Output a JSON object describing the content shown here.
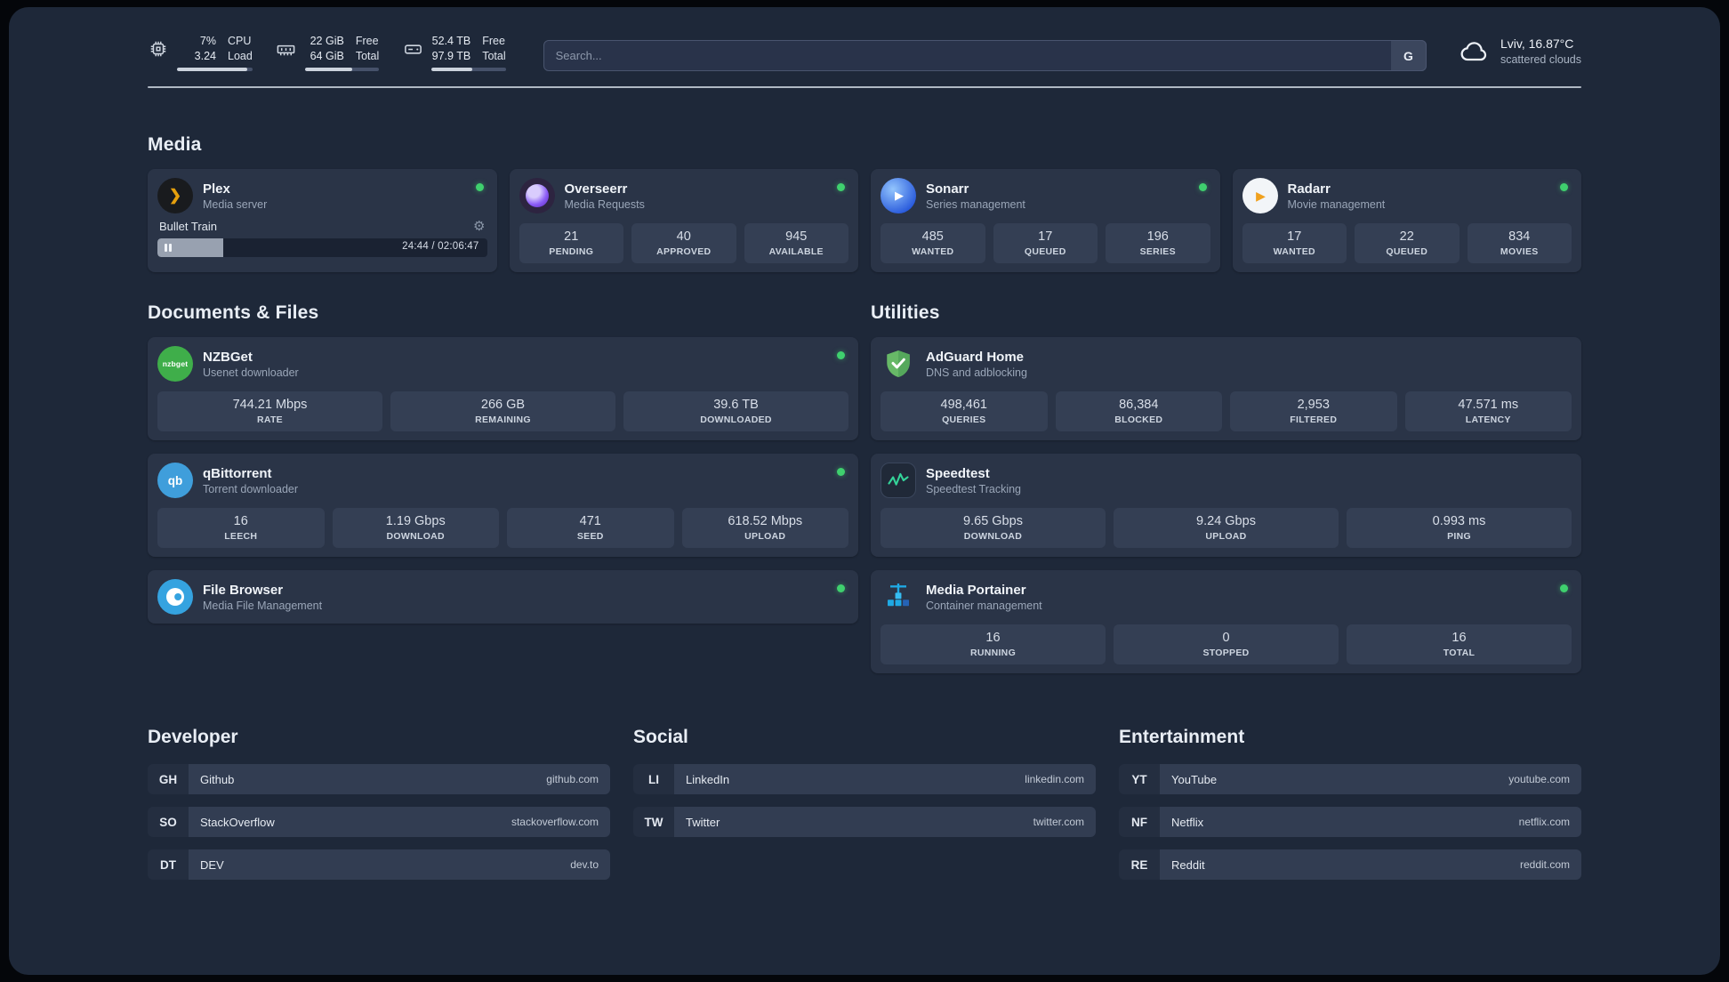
{
  "topbar": {
    "cpu": {
      "value_top": "7%",
      "value_bottom": "3.24",
      "label_top": "CPU",
      "label_bottom": "Load"
    },
    "memory": {
      "value_top": "22 GiB",
      "value_bottom": "64 GiB",
      "label_top": "Free",
      "label_bottom": "Total"
    },
    "disk": {
      "value_top": "52.4 TB",
      "value_bottom": "97.9 TB",
      "label_top": "Free",
      "label_bottom": "Total"
    },
    "search": {
      "placeholder": "Search...",
      "provider_button": "G"
    },
    "weather": {
      "location": "Lviv, 16.87°C",
      "condition": "scattered clouds"
    }
  },
  "sections": {
    "media": {
      "title": "Media"
    },
    "documents": {
      "title": "Documents & Files"
    },
    "utilities": {
      "title": "Utilities"
    }
  },
  "services": {
    "plex": {
      "name": "Plex",
      "subtitle": "Media server",
      "status": "online",
      "now_playing": "Bullet Train",
      "time": "24:44 / 02:06:47"
    },
    "overseerr": {
      "name": "Overseerr",
      "subtitle": "Media Requests",
      "status": "online",
      "stats": [
        {
          "value": "21",
          "label": "PENDING"
        },
        {
          "value": "40",
          "label": "APPROVED"
        },
        {
          "value": "945",
          "label": "AVAILABLE"
        }
      ]
    },
    "sonarr": {
      "name": "Sonarr",
      "subtitle": "Series management",
      "status": "online",
      "stats": [
        {
          "value": "485",
          "label": "WANTED"
        },
        {
          "value": "17",
          "label": "QUEUED"
        },
        {
          "value": "196",
          "label": "SERIES"
        }
      ]
    },
    "radarr": {
      "name": "Radarr",
      "subtitle": "Movie management",
      "status": "online",
      "stats": [
        {
          "value": "17",
          "label": "WANTED"
        },
        {
          "value": "22",
          "label": "QUEUED"
        },
        {
          "value": "834",
          "label": "MOVIES"
        }
      ]
    },
    "nzbget": {
      "name": "NZBGet",
      "subtitle": "Usenet downloader",
      "status": "online",
      "stats": [
        {
          "value": "744.21 Mbps",
          "label": "RATE"
        },
        {
          "value": "266 GB",
          "label": "REMAINING"
        },
        {
          "value": "39.6 TB",
          "label": "DOWNLOADED"
        }
      ]
    },
    "qbittorrent": {
      "name": "qBittorrent",
      "subtitle": "Torrent downloader",
      "status": "online",
      "stats": [
        {
          "value": "16",
          "label": "LEECH"
        },
        {
          "value": "1.19 Gbps",
          "label": "DOWNLOAD"
        },
        {
          "value": "471",
          "label": "SEED"
        },
        {
          "value": "618.52 Mbps",
          "label": "UPLOAD"
        }
      ]
    },
    "filebrowser": {
      "name": "File Browser",
      "subtitle": "Media File Management",
      "status": "online"
    },
    "adguard": {
      "name": "AdGuard Home",
      "subtitle": "DNS and adblocking",
      "stats": [
        {
          "value": "498,461",
          "label": "QUERIES"
        },
        {
          "value": "86,384",
          "label": "BLOCKED"
        },
        {
          "value": "2,953",
          "label": "FILTERED"
        },
        {
          "value": "47.571 ms",
          "label": "LATENCY"
        }
      ]
    },
    "speedtest": {
      "name": "Speedtest",
      "subtitle": "Speedtest Tracking",
      "stats": [
        {
          "value": "9.65 Gbps",
          "label": "DOWNLOAD"
        },
        {
          "value": "9.24 Gbps",
          "label": "UPLOAD"
        },
        {
          "value": "0.993 ms",
          "label": "PING"
        }
      ]
    },
    "portainer": {
      "name": "Media Portainer",
      "subtitle": "Container management",
      "status": "online",
      "stats": [
        {
          "value": "16",
          "label": "RUNNING"
        },
        {
          "value": "0",
          "label": "STOPPED"
        },
        {
          "value": "16",
          "label": "TOTAL"
        }
      ]
    }
  },
  "bookmarks": {
    "developer": {
      "title": "Developer",
      "items": [
        {
          "abbr": "GH",
          "name": "Github",
          "domain": "github.com"
        },
        {
          "abbr": "SO",
          "name": "StackOverflow",
          "domain": "stackoverflow.com"
        },
        {
          "abbr": "DT",
          "name": "DEV",
          "domain": "dev.to"
        }
      ]
    },
    "social": {
      "title": "Social",
      "items": [
        {
          "abbr": "LI",
          "name": "LinkedIn",
          "domain": "linkedin.com"
        },
        {
          "abbr": "TW",
          "name": "Twitter",
          "domain": "twitter.com"
        }
      ]
    },
    "entertainment": {
      "title": "Entertainment",
      "items": [
        {
          "abbr": "YT",
          "name": "YouTube",
          "domain": "youtube.com"
        },
        {
          "abbr": "NF",
          "name": "Netflix",
          "domain": "netflix.com"
        },
        {
          "abbr": "RE",
          "name": "Reddit",
          "domain": "reddit.com"
        }
      ]
    }
  },
  "icons": {
    "plex_glyph": "❯",
    "sonarr_glyph": "▶",
    "radarr_glyph": "▶",
    "nzbget_text": "nzbget",
    "qbittorrent_text": "qb",
    "gear_glyph": "⚙"
  },
  "colors": {
    "background": "#1e2839",
    "card": "#2a3447",
    "tile": "#343f54",
    "status_online": "#3fd06e",
    "plex_amber": "#e5a00d",
    "overseerr_purple": "#8b5cf6",
    "sonarr_blue": "#1d4ed8",
    "radarr_amber": "#f0a11e",
    "nzbget_green": "#3fae4a",
    "qbittorrent_blue": "#3f9edb",
    "filebrowser_blue": "#35a3e0",
    "adguard_green": "#67b967",
    "speedtest_green": "#34d399",
    "portainer_blue": "#1fa9e4"
  }
}
